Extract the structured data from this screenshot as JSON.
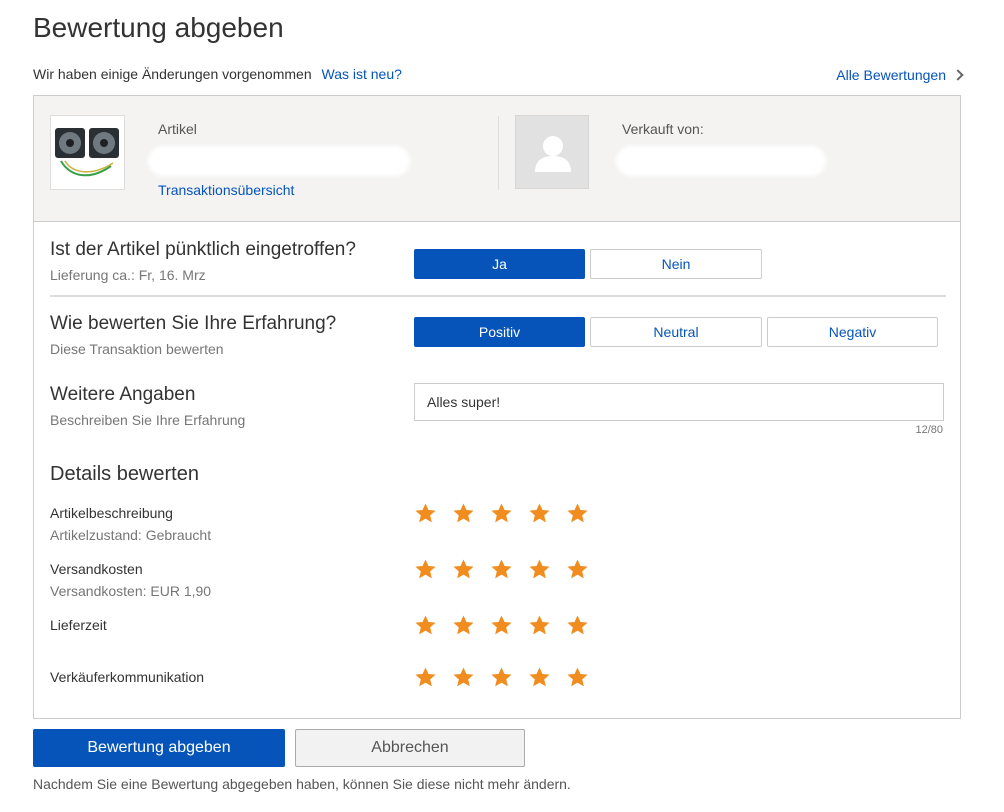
{
  "page": {
    "title": "Bewertung abgeben",
    "changes_text": "Wir haben einige Änderungen vorgenommen",
    "whats_new_link": "Was ist neu?",
    "all_ratings_link": "Alle Bewertungen"
  },
  "item": {
    "label": "Artikel",
    "transaction_link": "Transaktionsübersicht",
    "seller_label": "Verkauft von:"
  },
  "questions": {
    "arrival": {
      "title": "Ist der Artikel pünktlich eingetroffen?",
      "sub": "Lieferung ca.: Fr, 16. Mrz",
      "options": [
        "Ja",
        "Nein"
      ],
      "selected": "Ja"
    },
    "experience": {
      "title": "Wie bewerten Sie Ihre Erfahrung?",
      "sub": "Diese Transaktion bewerten",
      "options": [
        "Positiv",
        "Neutral",
        "Negativ"
      ],
      "selected": "Positiv"
    },
    "comment": {
      "title": "Weitere Angaben",
      "sub": "Beschreiben Sie Ihre Erfahrung",
      "value": "Alles super!",
      "char_count": "12/80"
    }
  },
  "details": {
    "title": "Details bewerten",
    "rows": [
      {
        "label": "Artikelbeschreibung",
        "sub": "Artikelzustand: Gebraucht",
        "stars": 5,
        "max": 5
      },
      {
        "label": "Versandkosten",
        "sub": "Versandkosten: EUR 1,90",
        "stars": 5,
        "max": 5
      },
      {
        "label": "Lieferzeit",
        "sub": "",
        "stars": 5,
        "max": 5
      },
      {
        "label": "Verkäuferkommunikation",
        "sub": "",
        "stars": 5,
        "max": 5
      }
    ]
  },
  "actions": {
    "submit": "Bewertung abgeben",
    "cancel": "Abbrechen",
    "note": "Nachdem Sie eine Bewertung abgegeben haben, können Sie diese nicht mehr ändern."
  },
  "colors": {
    "primary": "#0654ba",
    "star": "#f18c1e"
  }
}
